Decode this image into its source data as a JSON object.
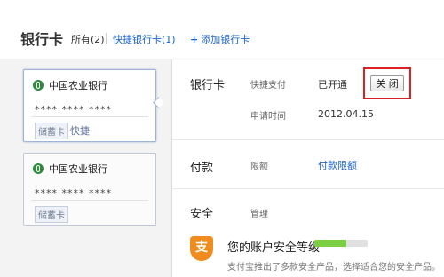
{
  "header": {
    "title": "银行卡",
    "tab_all": "所有(2)",
    "tab_quick": "快捷银行卡(1)",
    "add_label": "添加银行卡",
    "add_plus": "+"
  },
  "cards": [
    {
      "bank_name": "中国农业银行",
      "number": "**** **** ****",
      "type": "储蓄卡",
      "extra": "快捷"
    },
    {
      "bank_name": "中国农业银行",
      "number": "**** **** ****",
      "type": "储蓄卡",
      "extra": ""
    }
  ],
  "details": {
    "bank_section": {
      "title": "银行卡",
      "quick_pay_label": "快捷支付",
      "quick_pay_value": "已开通",
      "close_button": "关 闭",
      "apply_time_label": "申请时间",
      "apply_time_value": "2012.04.15"
    },
    "payment_section": {
      "title": "付款",
      "limit_label": "限额",
      "limit_link": "付款限额"
    },
    "security_section": {
      "title": "安全",
      "manage_label": "管理",
      "level_title": "您的账户安全等级",
      "level_desc": "支付宝推出了多款安全产品，选择适合您的安全产品。",
      "shield_char": "支",
      "level_fill": 0.6
    }
  },
  "colors": {
    "link": "#1b63c8",
    "highlight_outline": "#e02020",
    "shield": "#f08c1e",
    "bank_logo": "#2e8b3d"
  }
}
